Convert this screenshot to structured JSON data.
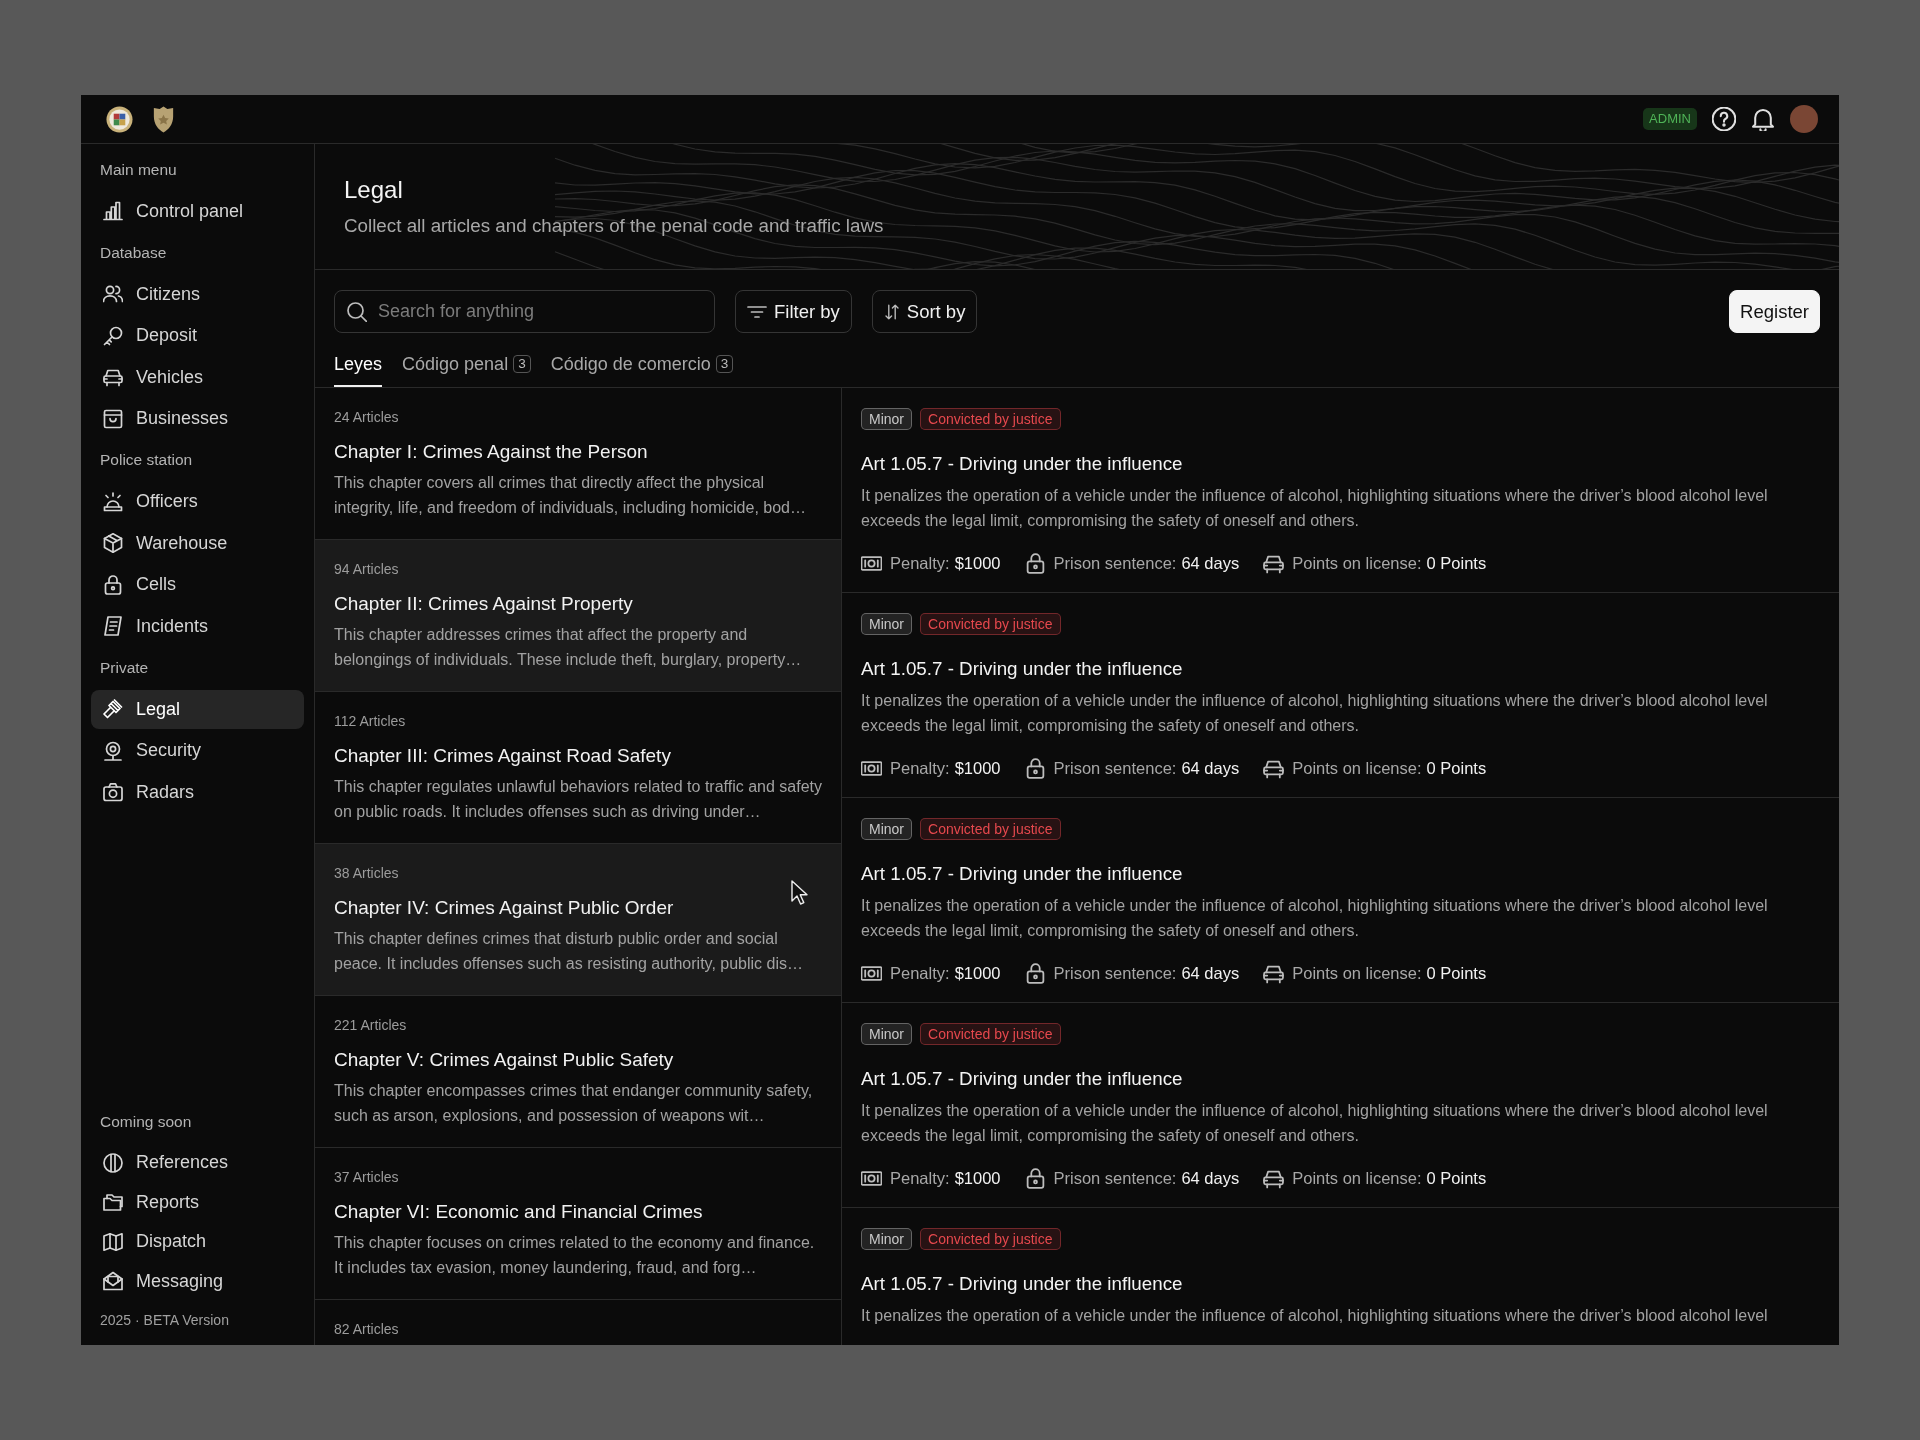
{
  "topbar": {
    "role_badge": "ADMIN"
  },
  "sidebar": {
    "sections": [
      {
        "heading": "Main menu",
        "items": [
          {
            "label": "Control panel",
            "selected": false
          }
        ]
      },
      {
        "heading": "Database",
        "items": [
          {
            "label": "Citizens",
            "selected": false
          },
          {
            "label": "Deposit",
            "selected": false
          },
          {
            "label": "Vehicles",
            "selected": false
          },
          {
            "label": "Businesses",
            "selected": false
          }
        ]
      },
      {
        "heading": "Police station",
        "items": [
          {
            "label": "Officers",
            "selected": false
          },
          {
            "label": "Warehouse",
            "selected": false
          },
          {
            "label": "Cells",
            "selected": false
          },
          {
            "label": "Incidents",
            "selected": false
          }
        ]
      },
      {
        "heading": "Private",
        "items": [
          {
            "label": "Legal",
            "selected": true
          },
          {
            "label": "Security",
            "selected": false
          },
          {
            "label": "Radars",
            "selected": false
          }
        ]
      }
    ],
    "coming_soon": {
      "heading": "Coming soon",
      "items": [
        {
          "label": "References",
          "selected": false
        },
        {
          "label": "Reports",
          "selected": false
        },
        {
          "label": "Dispatch",
          "selected": false
        },
        {
          "label": "Messaging",
          "selected": false
        }
      ]
    },
    "footer": "2025 · BETA Version"
  },
  "page_header": {
    "title": "Legal",
    "subtitle": "Collect all articles and chapters of the penal code and traffic laws"
  },
  "toolbar": {
    "search": {
      "placeholder": "Search for anything"
    },
    "filter_button": "Filter by",
    "sort_button": "Sort by",
    "register_button": "Register"
  },
  "tabs": [
    {
      "label": "Leyes",
      "selected": true
    },
    {
      "label": "Código penal",
      "count": "3",
      "selected": false
    },
    {
      "label": "Código de comercio",
      "count": "3",
      "selected": false
    }
  ],
  "chapters": [
    {
      "count": "24 Articles",
      "title": "Chapter I: Crimes Against the Person",
      "description": "This chapter covers all crimes that directly affect the physical integrity, life, and freedom of individuals, including homicide, bod…",
      "selected": false
    },
    {
      "count": "94 Articles",
      "title": "Chapter II: Crimes Against Property",
      "description": "This chapter addresses crimes that affect the property and belongings of individuals. These include theft, burglary, property…",
      "selected": true
    },
    {
      "count": "112 Articles",
      "title": "Chapter III: Crimes Against Road Safety",
      "description": "This chapter regulates unlawful behaviors related to traffic and safety on public roads. It includes offenses such as driving under…",
      "selected": false
    },
    {
      "count": "38 Articles",
      "title": "Chapter IV: Crimes Against Public Order",
      "description": "This chapter defines crimes that disturb public order and social peace. It includes offenses such as resisting authority, public dis…",
      "selected": true
    },
    {
      "count": "221 Articles",
      "title": "Chapter V: Crimes Against Public Safety",
      "description": "This chapter encompasses crimes that endanger community safety, such as arson, explosions, and possession of weapons wit…",
      "selected": false
    },
    {
      "count": "37 Articles",
      "title": "Chapter VI: Economic and Financial Crimes",
      "description": "This chapter focuses on crimes related to the economy and finance. It includes tax evasion, money laundering, fraud, and forg…",
      "selected": false
    },
    {
      "count": "82 Articles",
      "selected": false
    }
  ],
  "articles": [
    {
      "tags": [
        {
          "label": "Minor",
          "color": "#c8c8c8"
        },
        {
          "label": "Convicted by justice",
          "color": "#e5484d"
        }
      ],
      "title": "Art 1.05.7 - Driving under the influence",
      "description": "It penalizes the operation of a vehicle under the influence of alcohol, highlighting situations where the driver’s blood alcohol level exceeds the legal limit, compromising the safety of oneself and others.",
      "details": [
        {
          "kind": "penalty",
          "label": "Penalty:",
          "value": "$1000"
        },
        {
          "kind": "prison",
          "label": "Prison sentence:",
          "value": "64 days"
        },
        {
          "kind": "points",
          "label": "Points on license:",
          "value": "0 Points"
        }
      ]
    },
    {
      "tags": [
        {
          "label": "Minor",
          "color": "#c8c8c8"
        },
        {
          "label": "Convicted by justice",
          "color": "#e5484d"
        }
      ],
      "title": "Art 1.05.7 - Driving under the influence",
      "description": "It penalizes the operation of a vehicle under the influence of alcohol, highlighting situations where the driver’s blood alcohol level exceeds the legal limit, compromising the safety of oneself and others.",
      "details": [
        {
          "kind": "penalty",
          "label": "Penalty:",
          "value": "$1000"
        },
        {
          "kind": "prison",
          "label": "Prison sentence:",
          "value": "64 days"
        },
        {
          "kind": "points",
          "label": "Points on license:",
          "value": "0 Points"
        }
      ]
    },
    {
      "tags": [
        {
          "label": "Minor",
          "color": "#c8c8c8"
        },
        {
          "label": "Convicted by justice",
          "color": "#e5484d"
        }
      ],
      "title": "Art 1.05.7 - Driving under the influence",
      "description": "It penalizes the operation of a vehicle under the influence of alcohol, highlighting situations where the driver’s blood alcohol level exceeds the legal limit, compromising the safety of oneself and others.",
      "details": [
        {
          "kind": "penalty",
          "label": "Penalty:",
          "value": "$1000"
        },
        {
          "kind": "prison",
          "label": "Prison sentence:",
          "value": "64 days"
        },
        {
          "kind": "points",
          "label": "Points on license:",
          "value": "0 Points"
        }
      ]
    },
    {
      "tags": [
        {
          "label": "Minor",
          "color": "#c8c8c8"
        },
        {
          "label": "Convicted by justice",
          "color": "#e5484d"
        }
      ],
      "title": "Art 1.05.7 - Driving under the influence",
      "description": "It penalizes the operation of a vehicle under the influence of alcohol, highlighting situations where the driver’s blood alcohol level exceeds the legal limit, compromising the safety of oneself and others.",
      "details": [
        {
          "kind": "penalty",
          "label": "Penalty:",
          "value": "$1000"
        },
        {
          "kind": "prison",
          "label": "Prison sentence:",
          "value": "64 days"
        },
        {
          "kind": "points",
          "label": "Points on license:",
          "value": "0 Points"
        }
      ]
    },
    {
      "tags": [
        {
          "label": "Minor",
          "color": "#c8c8c8"
        },
        {
          "label": "Convicted by justice",
          "color": "#e5484d"
        }
      ],
      "title": "Art 1.05.7 - Driving under the influence",
      "description": "It penalizes the operation of a vehicle under the influence of alcohol, highlighting situations where the driver’s blood alcohol level"
    }
  ]
}
